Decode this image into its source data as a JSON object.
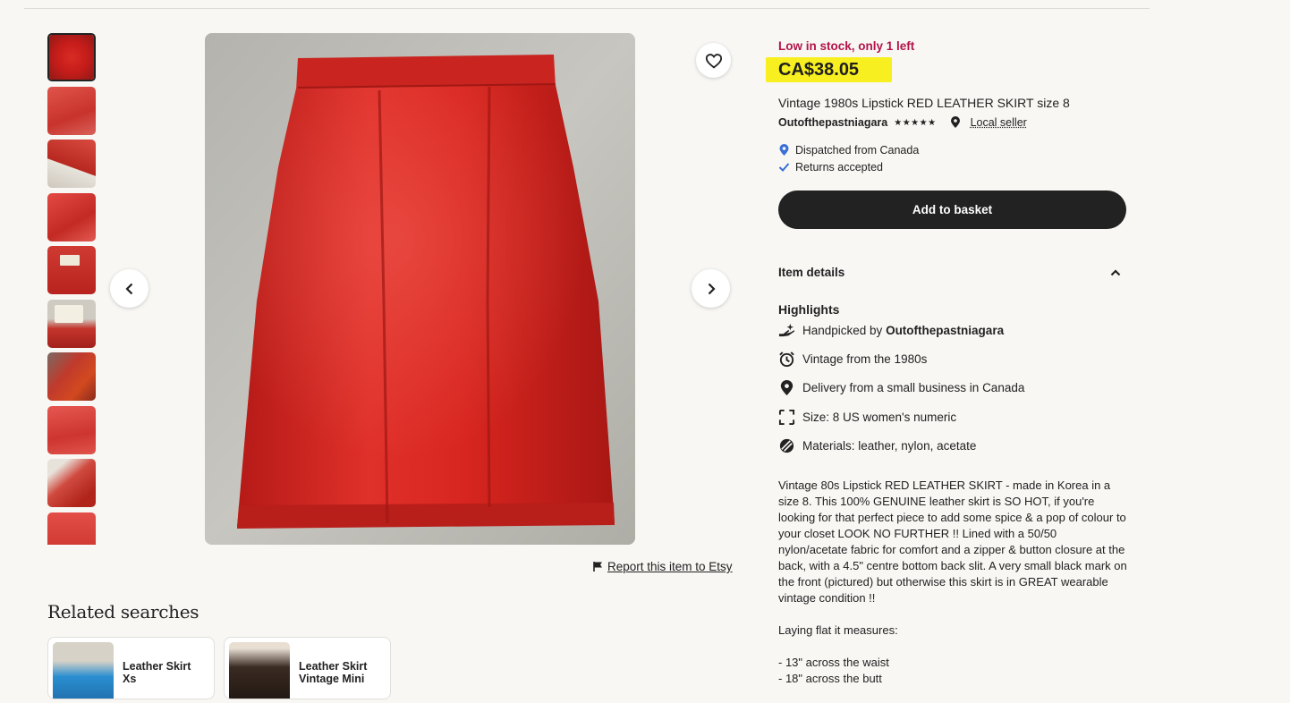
{
  "gallery": {
    "thumbnail_count": 10,
    "prev_label": "previous-image",
    "next_label": "next-image",
    "report_label": "Report this item to Etsy"
  },
  "related": {
    "title": "Related searches",
    "items": [
      {
        "label": "Leather Skirt Xs"
      },
      {
        "label": "Leather Skirt Vintage Mini"
      }
    ]
  },
  "listing": {
    "stock_notice": "Low in stock, only 1 left",
    "price": "CA$38.05",
    "title": "Vintage 1980s Lipstick RED LEATHER SKIRT size 8",
    "seller": "Outofthepastniagara",
    "rating_stars": "★★★★★",
    "local_seller": "Local seller",
    "dispatched": "Dispatched from Canada",
    "returns": "Returns accepted",
    "add_to_basket": "Add to basket",
    "item_details": "Item details",
    "highlights_title": "Highlights",
    "highlights": {
      "handpicked_prefix": "Handpicked by ",
      "handpicked_seller": "Outofthepastniagara",
      "vintage": "Vintage from the 1980s",
      "delivery": "Delivery from a small business in Canada",
      "size": "Size: 8 US women's numeric",
      "materials": "Materials: leather, nylon, acetate"
    },
    "description": [
      "Vintage 80s Lipstick RED LEATHER SKIRT - made in Korea in a size 8. This 100% GENUINE leather skirt is SO HOT, if you're looking for that perfect piece to add some spice & a pop of colour to your closet LOOK NO FURTHER !! Lined with a 50/50 nylon/acetate fabric for comfort and a zipper & button closure at the back, with a 4.5\" centre bottom back slit. A very small black mark on the front (pictured) but otherwise this skirt is in GREAT wearable vintage condition !!",
      "Laying flat it measures:",
      "- 13\" across the waist\n- 18\" across the butt"
    ]
  },
  "colors": {
    "stock_red": "#b3134a",
    "highlight_yellow": "#f7ef1f",
    "button_dark": "#222222",
    "skirt_red": "#d9201e"
  }
}
